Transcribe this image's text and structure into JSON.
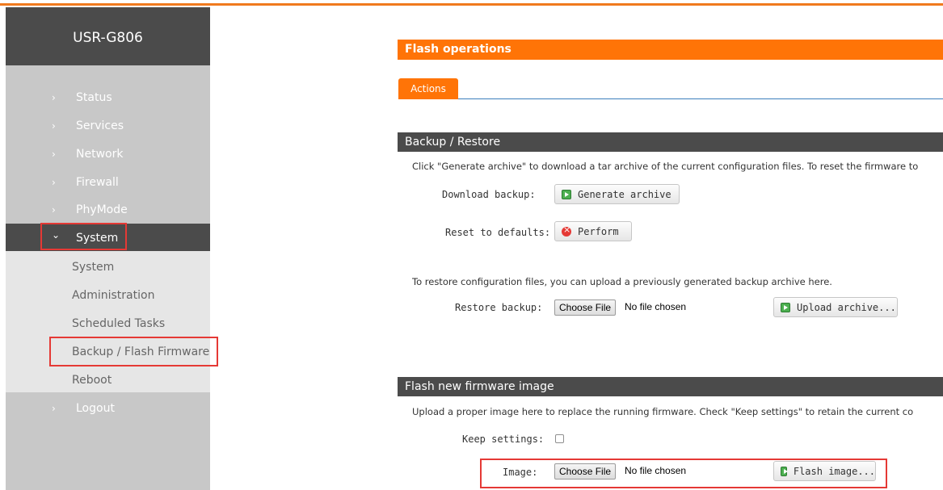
{
  "brand": "USR-G806",
  "nav": {
    "items": [
      {
        "label": "Status"
      },
      {
        "label": "Services"
      },
      {
        "label": "Network"
      },
      {
        "label": "Firewall"
      },
      {
        "label": "PhyMode"
      },
      {
        "label": "System"
      },
      {
        "label": "Logout"
      }
    ],
    "chev_right": "›",
    "chev_down": "⌄",
    "system_submenu": [
      {
        "label": "System"
      },
      {
        "label": "Administration"
      },
      {
        "label": "Scheduled Tasks"
      },
      {
        "label": "Backup / Flash Firmware"
      },
      {
        "label": "Reboot"
      }
    ]
  },
  "main": {
    "header": "Flash operations",
    "tab": "Actions",
    "backup": {
      "title": "Backup / Restore",
      "desc": "Click \"Generate archive\" to download a tar archive of the current configuration files. To reset the firmware to",
      "download_label": "Download backup:",
      "generate_btn": "Generate archive",
      "reset_label": "Reset to defaults:",
      "perform_btn": "Perform",
      "restore_desc": "To restore configuration files, you can upload a previously generated backup archive here.",
      "restore_label": "Restore backup:",
      "choose_file": "Choose File",
      "no_file": "No file chosen",
      "upload_btn": "Upload archive..."
    },
    "flash": {
      "title": "Flash new firmware image",
      "desc": "Upload a proper image here to replace the running firmware. Check \"Keep settings\" to retain the current co",
      "keep_label": "Keep settings:",
      "image_label": "Image:",
      "choose_file": "Choose File",
      "no_file": "No file chosen",
      "flash_btn": "Flash image..."
    }
  },
  "colors": {
    "accent": "#ff7407",
    "dark": "#4b4b4b",
    "highlight": "#e53935"
  }
}
